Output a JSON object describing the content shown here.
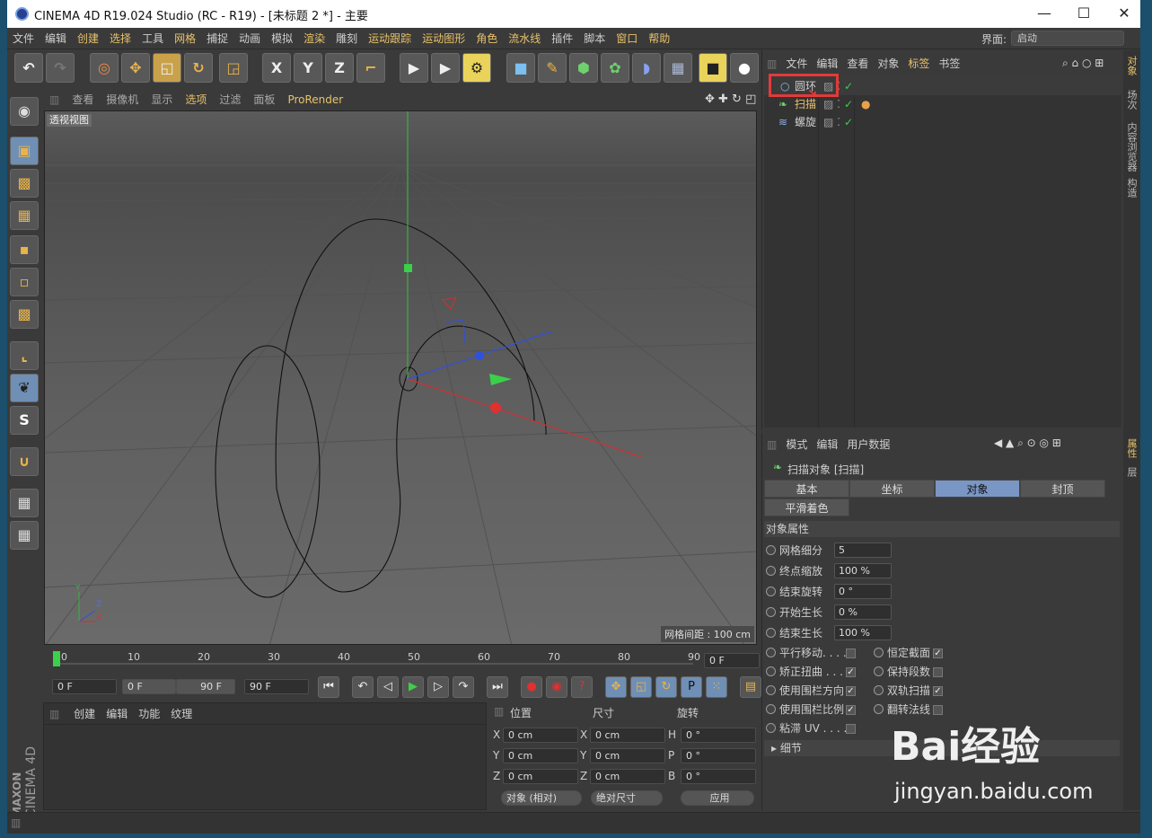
{
  "window": {
    "title": "CINEMA 4D R19.024 Studio (RC - R19) - [未标题 2 *] - 主要",
    "min": "—",
    "max": "☐",
    "close": "✕"
  },
  "menu": [
    "文件",
    "编辑",
    "创建",
    "选择",
    "工具",
    "网格",
    "捕捉",
    "动画",
    "模拟",
    "渲染",
    "雕刻",
    "运动跟踪",
    "运动图形",
    "角色",
    "流水线",
    "插件",
    "脚本",
    "窗口",
    "帮助"
  ],
  "layout": {
    "label": "界面:",
    "value": "启动"
  },
  "toolbar": {
    "undo": "↶",
    "redo": "↷",
    "x": "X",
    "y": "Y",
    "z": "Z"
  },
  "viewport": {
    "menu": [
      "查看",
      "摄像机",
      "显示",
      "选项",
      "过滤",
      "面板",
      "ProRender"
    ],
    "label": "透视视图",
    "grid_spacing": "网格间距 : 100 cm",
    "axis_y": "Y",
    "axis_z": "Z",
    "axis_x": "X"
  },
  "timeline": {
    "ticks": [
      "0",
      "10",
      "20",
      "30",
      "40",
      "50",
      "60",
      "70",
      "80",
      "90"
    ],
    "current": "0 F",
    "start": "0 F",
    "range_start": "0 F",
    "range_end": "90 F",
    "end": "90 F"
  },
  "materials": {
    "menu": [
      "创建",
      "编辑",
      "功能",
      "纹理"
    ]
  },
  "coords": {
    "headers": [
      "位置",
      "尺寸",
      "旋转"
    ],
    "rows": [
      {
        "a": "X",
        "av": "0 cm",
        "b": "X",
        "bv": "0 cm",
        "c": "H",
        "cv": "0 °"
      },
      {
        "a": "Y",
        "av": "0 cm",
        "b": "Y",
        "bv": "0 cm",
        "c": "P",
        "cv": "0 °"
      },
      {
        "a": "Z",
        "av": "0 cm",
        "b": "Z",
        "bv": "0 cm",
        "c": "B",
        "cv": "0 °"
      }
    ],
    "mode": "对象 (相对)",
    "size_mode": "绝对尺寸",
    "apply": "应用"
  },
  "objects": {
    "menu": [
      "文件",
      "编辑",
      "查看",
      "对象",
      "标签",
      "书签"
    ],
    "items": [
      {
        "name": "圆环",
        "icon": "circle"
      },
      {
        "name": "扫描",
        "icon": "sweep"
      },
      {
        "name": "螺旋",
        "icon": "helix"
      }
    ]
  },
  "attributes": {
    "menu": [
      "模式",
      "编辑",
      "用户数据"
    ],
    "title": "扫描对象 [扫描]",
    "tabs": [
      "基本",
      "坐标",
      "对象",
      "封顶"
    ],
    "active_tab": "对象",
    "phong": "平滑着色(Phong)",
    "section": "对象属性",
    "fields": [
      {
        "label": "网格细分",
        "value": "5"
      },
      {
        "label": "终点缩放",
        "value": "100 %"
      },
      {
        "label": "结束旋转",
        "value": "0 °"
      },
      {
        "label": "开始生长",
        "value": "0 %"
      },
      {
        "label": "结束生长",
        "value": "100 %"
      }
    ],
    "checks_left": [
      {
        "label": "平行移动. . . .",
        "checked": false
      },
      {
        "label": "矫正扭曲 . . . .",
        "checked": true
      },
      {
        "label": "使用围栏方向",
        "checked": true
      },
      {
        "label": "使用围栏比例",
        "checked": true
      },
      {
        "label": "粘滞 UV . . . .",
        "checked": false
      }
    ],
    "checks_right": [
      {
        "label": "恒定截面",
        "checked": true
      },
      {
        "label": "保持段数",
        "checked": false
      },
      {
        "label": "双轨扫描",
        "checked": true
      },
      {
        "label": "翻转法线",
        "checked": false
      }
    ],
    "detail": "细节"
  },
  "side_tabs": [
    "对象",
    "场次",
    "内容浏览器",
    "构造"
  ],
  "side_tabs2": [
    "属性",
    "层"
  ],
  "brand": {
    "maxon": "MAXON",
    "c4d": "CINEMA 4D"
  },
  "watermark": {
    "text": "Bai经验",
    "sub": "jingyan.baidu.com"
  },
  "accent": "#e33a3a"
}
